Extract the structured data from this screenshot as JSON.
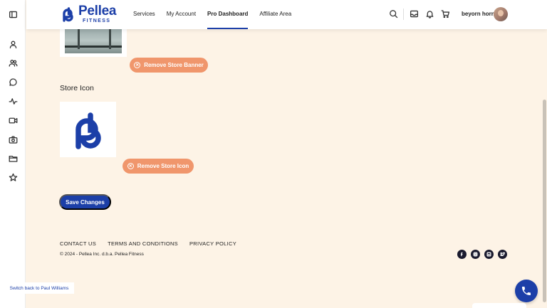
{
  "sidebar": {
    "icons": [
      {
        "name": "sidebar-toggle-icon"
      },
      {
        "name": "user-icon"
      },
      {
        "name": "users-icon"
      },
      {
        "name": "chat-icon"
      },
      {
        "name": "activity-icon"
      },
      {
        "name": "video-icon"
      },
      {
        "name": "camera-icon"
      },
      {
        "name": "folder-icon"
      },
      {
        "name": "star-icon"
      }
    ]
  },
  "header": {
    "logo_name": "Pellea",
    "logo_sub": "FITNESS",
    "nav": [
      {
        "label": "Services",
        "active": false
      },
      {
        "label": "My Account",
        "active": false
      },
      {
        "label": "Pro Dashboard",
        "active": true
      },
      {
        "label": "Affiliate Area",
        "active": false
      }
    ],
    "user_name": "beyorn horn",
    "accent": "#1c3fa8"
  },
  "main": {
    "remove_banner_label": "Remove Store Banner",
    "store_icon_title": "Store Icon",
    "remove_icon_label": "Remove Store Icon",
    "save_label": "Save Changes",
    "button_color": "#f0966c"
  },
  "footer": {
    "links": [
      "CONTACT US",
      "TERMS AND CONDITIONS",
      "PRIVACY POLICY"
    ],
    "copyright": "© 2024 - Pellea Inc. d.b.a. Pellea Fitness",
    "social": [
      "facebook-icon",
      "instagram-icon",
      "linkedin-icon",
      "twitter-icon"
    ]
  },
  "overlay": {
    "switch_back_label": "Switch back to Paul Williams"
  }
}
